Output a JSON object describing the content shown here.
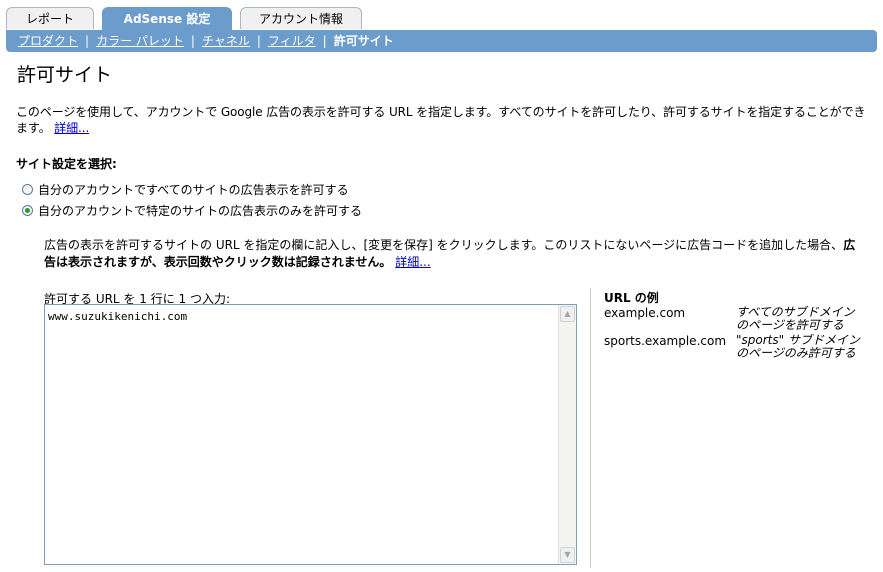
{
  "tabs": [
    {
      "label": "レポート"
    },
    {
      "label": "AdSense 設定"
    },
    {
      "label": "アカウント情報"
    }
  ],
  "subnav": {
    "items": [
      "プロダクト",
      "カラー パレット",
      "チャネル",
      "フィルタ"
    ],
    "current": "許可サイト",
    "separator": "|"
  },
  "page": {
    "title": "許可サイト",
    "intro": "このページを使用して、アカウントで Google 広告の表示を許可する URL を指定します。すべてのサイトを許可したり、許可するサイトを指定することができます。",
    "intro_link": "詳細...",
    "section_label": "サイト設定を選択:",
    "radio_all": "自分のアカウントですべてのサイトの広告表示を許可する",
    "radio_specific": "自分のアカウントで特定のサイトの広告表示のみを許可する",
    "instructions_part1": "広告の表示を許可するサイトの URL を指定の欄に記入し、[変更を保存] をクリックします。このリストにないページに広告コードを追加した場合、",
    "instructions_bold": "広告は表示されますが、表示回数やクリック数は記録されません。",
    "instructions_link": "詳細...",
    "input_label": "許可する URL を 1 行に 1 つ入力:",
    "input_value": "www.suzukikenichi.com"
  },
  "examples": {
    "title": "URL の例",
    "rows": [
      {
        "url": "example.com",
        "desc": "すべてのサブドメインのページを許可する"
      },
      {
        "url": "sports.example.com",
        "desc": "\"sports\" サブドメインのページのみ許可する"
      }
    ]
  }
}
